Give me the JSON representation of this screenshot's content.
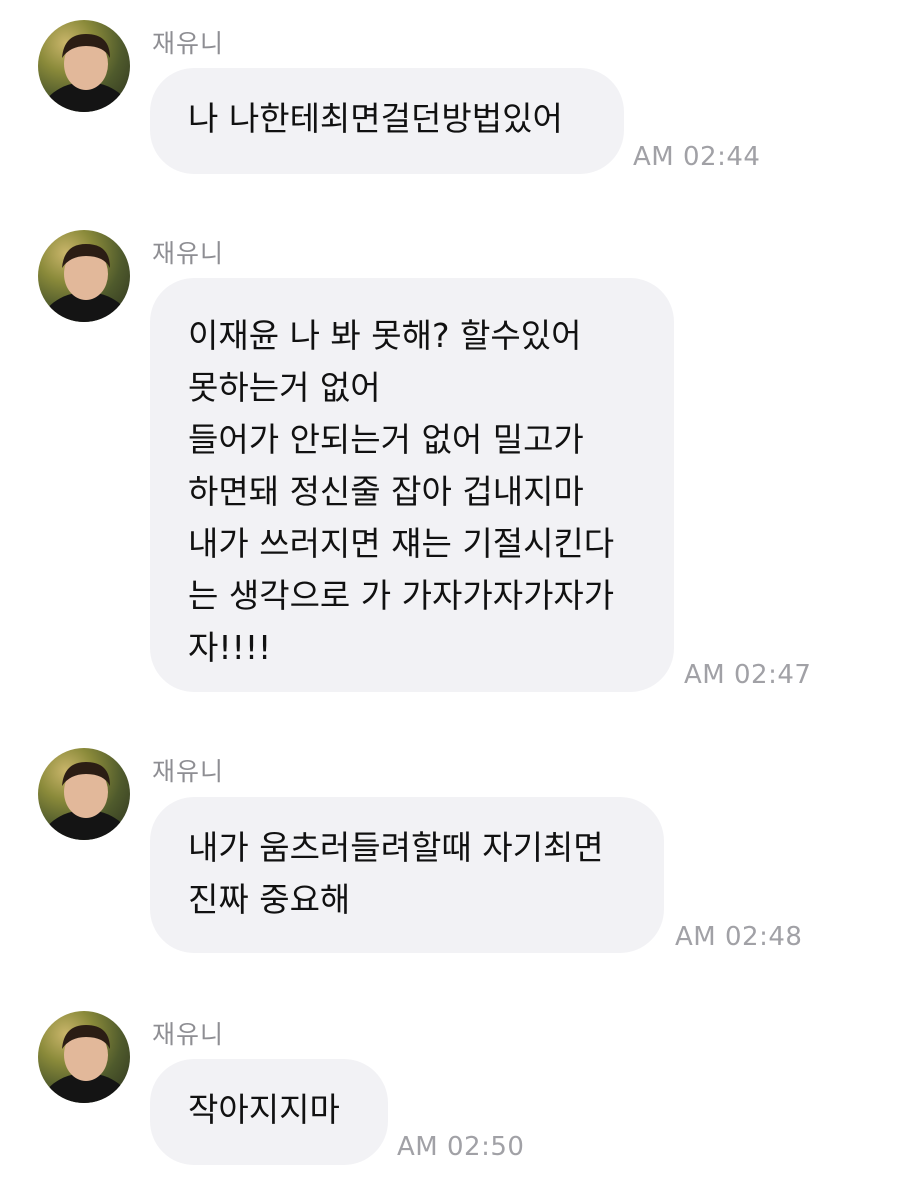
{
  "messages": [
    {
      "sender": "재유니",
      "lines": [
        "나 나한테최면걸던방법있어"
      ],
      "time": "AM 02:44"
    },
    {
      "sender": "재유니",
      "lines": [
        "이재윤 나 봐 못해? 할수있어",
        "못하는거 없어",
        "들어가 안되는거 없어 밀고가",
        "하면돼 정신줄 잡아 겁내지마",
        "내가 쓰러지면 쟤는 기절시킨다",
        "는 생각으로 가 가자가자가자가",
        "자!!!!"
      ],
      "time": "AM 02:47"
    },
    {
      "sender": "재유니",
      "lines": [
        "내가 움츠러들려할때 자기최면",
        "진짜 중요해"
      ],
      "time": "AM 02:48"
    },
    {
      "sender": "재유니",
      "lines": [
        "작아지지마"
      ],
      "time": "AM 02:50"
    }
  ]
}
